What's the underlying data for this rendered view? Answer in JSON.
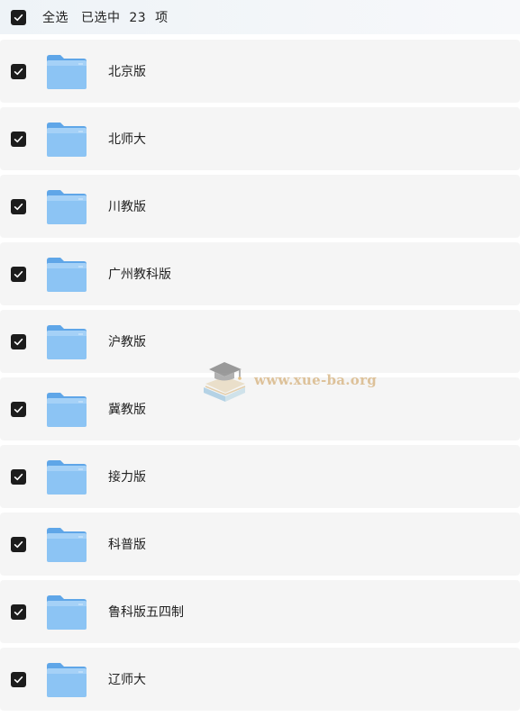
{
  "header": {
    "select_all_label": "全选",
    "selected_text": "已选中  23  项"
  },
  "items": [
    {
      "label": "北京版",
      "checked": true,
      "icon": "folder-icon"
    },
    {
      "label": "北师大",
      "checked": true,
      "icon": "folder-icon"
    },
    {
      "label": "川教版",
      "checked": true,
      "icon": "folder-icon"
    },
    {
      "label": "广州教科版",
      "checked": true,
      "icon": "folder-icon"
    },
    {
      "label": "沪教版",
      "checked": true,
      "icon": "folder-icon"
    },
    {
      "label": "冀教版",
      "checked": true,
      "icon": "folder-icon"
    },
    {
      "label": "接力版",
      "checked": true,
      "icon": "folder-icon"
    },
    {
      "label": "科普版",
      "checked": true,
      "icon": "folder-icon"
    },
    {
      "label": "鲁科版五四制",
      "checked": true,
      "icon": "folder-icon"
    },
    {
      "label": "辽师大",
      "checked": true,
      "icon": "folder-icon"
    }
  ],
  "watermark": {
    "text": "www.xue-ba.org"
  },
  "colors": {
    "checkbox": "#1c1c1c",
    "row_background": "#f5f5f5",
    "folder_blue": "#7fbcf2"
  }
}
